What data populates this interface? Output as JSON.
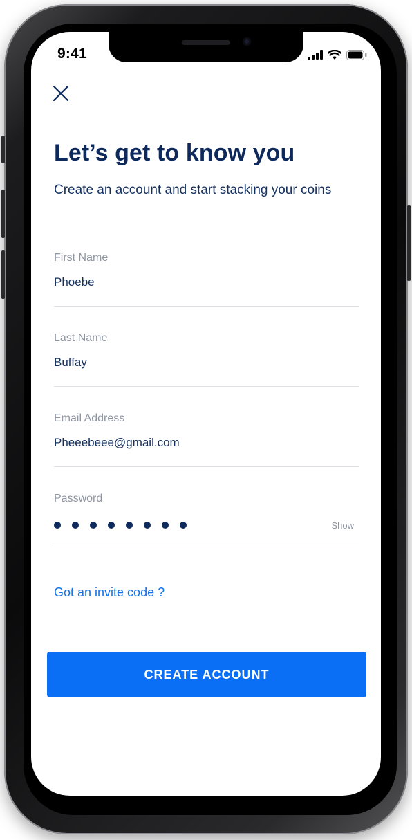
{
  "status_bar": {
    "time": "9:41",
    "icons": [
      "cellular-signal-icon",
      "wifi-icon",
      "battery-icon"
    ]
  },
  "header": {
    "close_icon": "close-icon"
  },
  "main": {
    "title": "Let’s get to know you",
    "subtitle": "Create an account and start stacking your coins"
  },
  "form": {
    "first_name": {
      "label": "First Name",
      "value": "Phoebe"
    },
    "last_name": {
      "label": "Last Name",
      "value": "Buffay"
    },
    "email": {
      "label": "Email Address",
      "value": "Pheeebeee@gmail.com"
    },
    "password": {
      "label": "Password",
      "masked_length": 8,
      "show_label": "Show"
    }
  },
  "invite_link": "Got an invite code ?",
  "cta": {
    "label": "CREATE ACCOUNT"
  },
  "colors": {
    "primary_button": "#0a6ff5",
    "link": "#1273ea",
    "heading": "#0e2a5c",
    "label": "#8e95a1",
    "divider": "#dcdfe5"
  }
}
